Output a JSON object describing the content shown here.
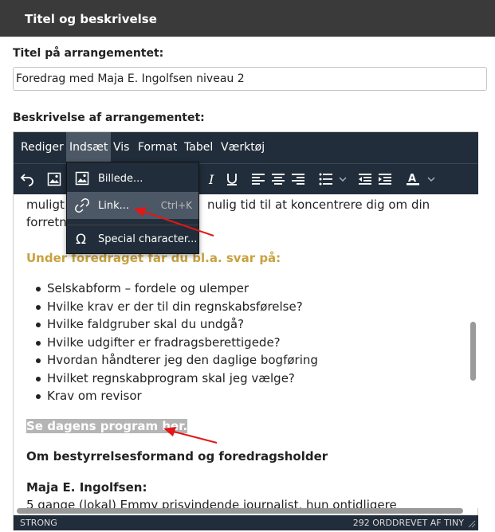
{
  "panel": {
    "title": "Titel og beskrivelse"
  },
  "form": {
    "title_label": "Titel på arrangementet:",
    "title_value": "Foredrag med Maja E. Ingolfsen niveau 2",
    "desc_label": "Beskrivelse af arrangementet:"
  },
  "menu": [
    "Rediger",
    "Indsæt",
    "Vis",
    "Format",
    "Tabel",
    "Værktøj"
  ],
  "dropdown": {
    "items": [
      {
        "icon": "image-icon",
        "label": "Billede...",
        "shortcut": ""
      },
      {
        "icon": "link-icon",
        "label": "Link...",
        "shortcut": "Ctrl+K"
      },
      {
        "icon": "omega-icon",
        "label": "Special character..."
      }
    ]
  },
  "content": {
    "line1": "muligt",
    "line1b": "nulig tid til at koncentrere dig om din",
    "line2": "forretn",
    "heading": "Under foredraget får du bl.a. svar på:",
    "bullets": [
      "Selskabform – fordele og ulemper",
      "Hvilke krav er der til din regnskabsførelse?",
      "Hvilke faldgruber skal du undgå?",
      "Hvilke udgifter er fradragsberettigede?",
      "Hvordan håndterer jeg den daglige bogføring",
      "Hvilket regnskabprogram skal jeg vælge?",
      "Krav om revisor"
    ],
    "selected": "Se dagens program her.",
    "sub1": "Om bestyrrelsesformand og foredragsholder",
    "sub2": "Maja E. Ingolfsen:",
    "cut": "5 gange (lokal) Emmy prisvindende journalist, hun ontidligere"
  },
  "statusbar": {
    "path": "STRONG",
    "count": "292 ORDDREVET AF TINY"
  },
  "colors": {
    "toolbar_bg": "#212d3a",
    "accent_orange": "#c8a23e",
    "arrow_red": "#e01818"
  }
}
